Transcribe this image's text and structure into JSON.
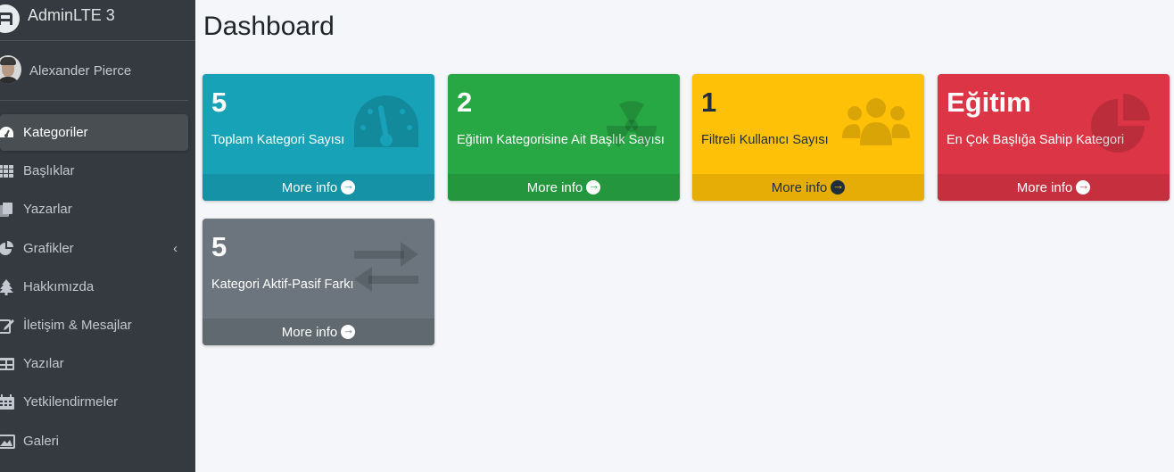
{
  "brand": {
    "title": "AdminLTE 3",
    "logo_icon": "adminlte-logo-icon"
  },
  "user": {
    "name": "Alexander Pierce",
    "avatar_icon": "user-avatar"
  },
  "sidebar": {
    "items": [
      {
        "label": "Kategoriler",
        "icon": "tachometer-icon",
        "active": true
      },
      {
        "label": "Başlıklar",
        "icon": "th-icon"
      },
      {
        "label": "Yazarlar",
        "icon": "copy-icon"
      },
      {
        "label": "Grafikler",
        "icon": "chart-pie-icon",
        "arrow": "‹"
      },
      {
        "label": "Hakkımızda",
        "icon": "tree-icon"
      },
      {
        "label": "İletişim & Mesajlar",
        "icon": "edit-icon"
      },
      {
        "label": "Yazılar",
        "icon": "table-icon"
      },
      {
        "label": "Yetkilendirmeler",
        "icon": "calendar-icon"
      },
      {
        "label": "Galeri",
        "icon": "image-icon"
      }
    ]
  },
  "page": {
    "title": "Dashboard"
  },
  "boxes": [
    {
      "number": "5",
      "label": "Toplam Kategori Sayısı",
      "footer": "More info",
      "color": "#17a2b8",
      "icon": "tachometer-icon"
    },
    {
      "number": "2",
      "label": "Eğitim Kategorisine Ait Başlık Sayısı",
      "footer": "More info",
      "color": "#28a745",
      "icon": "radiation-icon"
    },
    {
      "number": "1",
      "label": "Filtreli Kullanıcı Sayısı",
      "footer": "More info",
      "color": "#ffc107",
      "icon": "users-icon"
    },
    {
      "number": "Eğitim",
      "label": "En Çok Başlığa Sahip Kategori",
      "footer": "More info",
      "color": "#dc3545",
      "icon": "chart-pie-icon"
    },
    {
      "number": "5",
      "label": "Kategori Aktif-Pasif Farkı",
      "footer": "More info",
      "color": "#6c757d",
      "icon": "exchange-icon"
    }
  ]
}
